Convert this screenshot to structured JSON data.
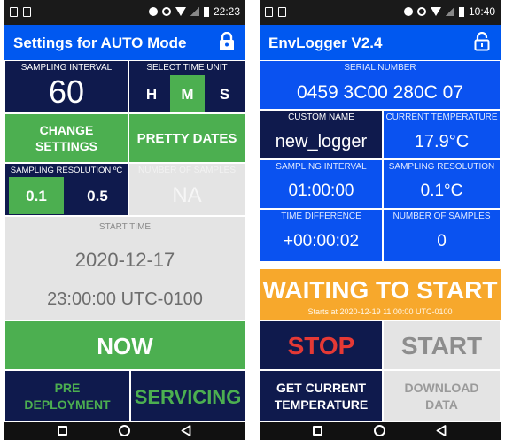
{
  "left": {
    "status": {
      "time": "22:23"
    },
    "appbar": {
      "title": "Settings for AUTO Mode"
    },
    "sampling_interval": {
      "label": "SAMPLING INTERVAL",
      "value": "60"
    },
    "time_unit": {
      "label": "SELECT TIME UNIT",
      "options": [
        "H",
        "M",
        "S"
      ],
      "selected": "M"
    },
    "change_settings": {
      "line1": "CHANGE",
      "line2": "SETTINGS"
    },
    "pretty_dates": "PRETTY DATES",
    "resolution": {
      "label": "SAMPLING RESOLUTION ºC",
      "options": [
        "0.1",
        "0.5"
      ],
      "selected": "0.1"
    },
    "disabled_field": {
      "label": "NUMBER OF SAMPLES",
      "value": "NA"
    },
    "start_time": {
      "label": "START TIME",
      "date": "2020-12-17",
      "time": "23:00:00 UTC-0100"
    },
    "now_button": "NOW",
    "pre_deployment": {
      "line1": "PRE",
      "line2": "DEPLOYMENT"
    },
    "servicing": "SERVICING"
  },
  "right": {
    "status": {
      "time": "10:40"
    },
    "appbar": {
      "title": "EnvLogger V2.4"
    },
    "serial": {
      "label": "SERIAL NUMBER",
      "value": "0459 3C00 280C 07"
    },
    "custom_name": {
      "label": "CUSTOM NAME",
      "value": "new_logger"
    },
    "current_temperature": {
      "label": "CURRENT TEMPERATURE",
      "value": "17.9°C"
    },
    "sampling_interval": {
      "label": "SAMPLING INTERVAL",
      "value": "01:00:00"
    },
    "sampling_resolution": {
      "label": "SAMPLING RESOLUTION",
      "value": "0.1°C"
    },
    "time_difference": {
      "label": "TIME DIFFERENCE",
      "value": "+00:00:02"
    },
    "number_of_samples": {
      "label": "NUMBER OF SAMPLES",
      "value": "0"
    },
    "waiting": {
      "title": "WAITING TO START",
      "subtitle": "Starts at 2020-12-19 11:00:00 UTC-0100"
    },
    "stop": "STOP",
    "start": "START",
    "get_temp": {
      "line1": "GET CURRENT",
      "line2": "TEMPERATURE"
    },
    "download": {
      "line1": "DOWNLOAD",
      "line2": "DATA"
    }
  },
  "colors": {
    "navy": "#0f1a4d",
    "green": "#4caf50",
    "blue": "#0a52f0",
    "appbar": "#0058f0",
    "grey": "#e4e4e4",
    "orange": "#f7a82c",
    "stop_red": "#e53935"
  },
  "icons": [
    "lock-icon",
    "unlock-icon",
    "nav-recents-icon",
    "nav-home-icon",
    "nav-back-icon"
  ]
}
